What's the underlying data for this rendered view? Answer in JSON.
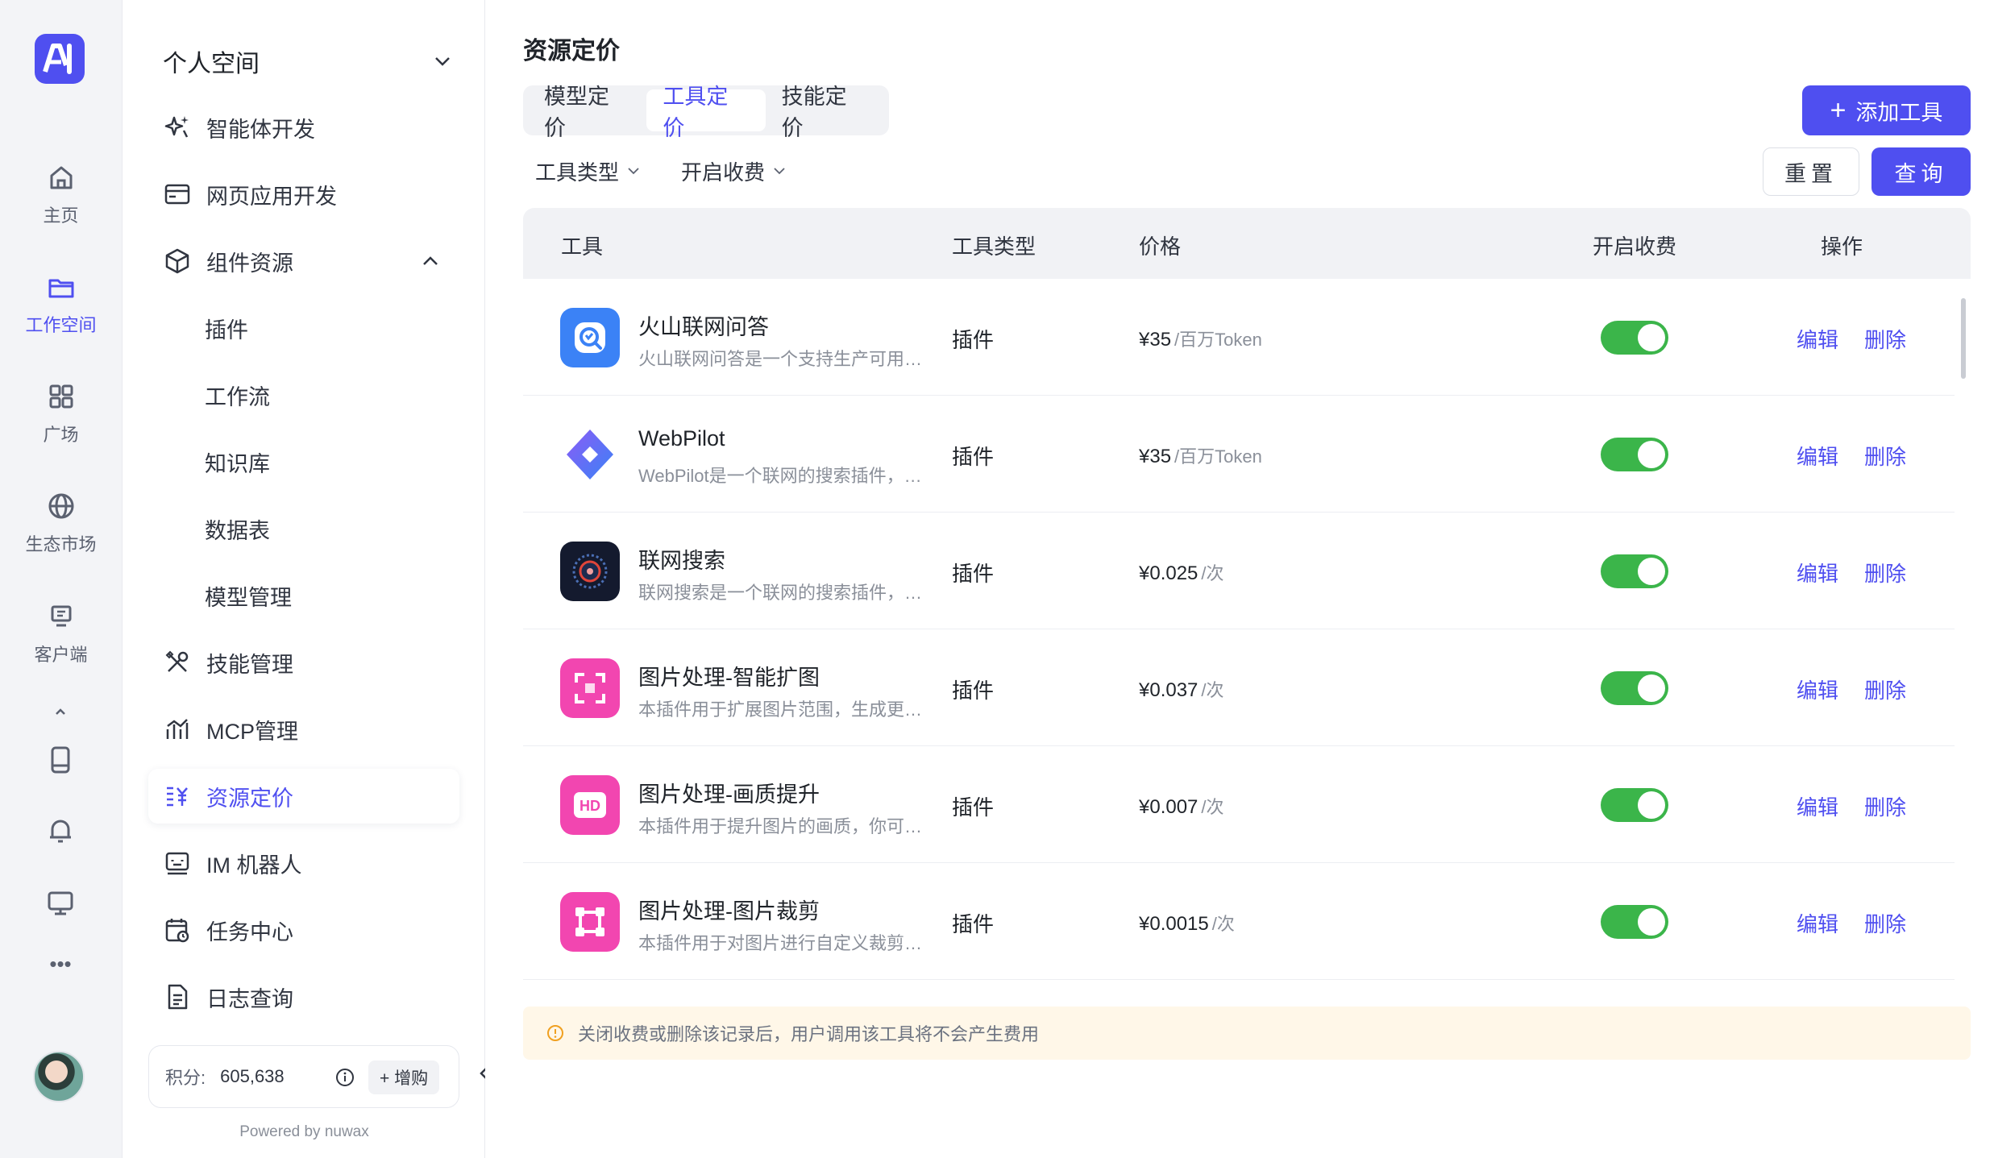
{
  "rail": {
    "items": [
      {
        "label": "主页",
        "icon": "home-icon"
      },
      {
        "label": "工作空间",
        "icon": "folder-icon",
        "active": true
      },
      {
        "label": "广场",
        "icon": "grid-icon"
      },
      {
        "label": "生态市场",
        "icon": "globe-icon"
      },
      {
        "label": "客户端",
        "icon": "client-icon"
      }
    ],
    "more_label": "•••"
  },
  "sidebar": {
    "workspace": "个人空间",
    "items": [
      {
        "label": "智能体开发"
      },
      {
        "label": "网页应用开发"
      },
      {
        "label": "组件资源"
      },
      {
        "label": "插件"
      },
      {
        "label": "工作流"
      },
      {
        "label": "知识库"
      },
      {
        "label": "数据表"
      },
      {
        "label": "模型管理"
      },
      {
        "label": "技能管理"
      },
      {
        "label": "MCP管理"
      },
      {
        "label": "资源定价"
      },
      {
        "label": "IM 机器人"
      },
      {
        "label": "任务中心"
      },
      {
        "label": "日志查询"
      }
    ],
    "credits_label": "积分:",
    "credits_value": "605,638",
    "buy_label": "+ 增购",
    "powered_by": "Powered by nuwax"
  },
  "main": {
    "title": "资源定价",
    "tabs": [
      "模型定价",
      "工具定价",
      "技能定价"
    ],
    "active_tab": "工具定价",
    "add_button": "添加工具",
    "filters": [
      "工具类型",
      "开启收费"
    ],
    "reset_button": "重置",
    "query_button": "查询",
    "columns": [
      "工具",
      "工具类型",
      "价格",
      "开启收费",
      "操作"
    ],
    "rows": [
      {
        "name": "火山联网问答",
        "desc": "火山联网问答是一个支持生产可用的联网问答插件",
        "type": "插件",
        "price": "¥35",
        "unit": "/百万Token",
        "enabled": true,
        "edit": "编辑",
        "delete": "删除"
      },
      {
        "name": "WebPilot",
        "desc": "WebPilot是一个联网的搜索插件，支持网页浏览",
        "type": "插件",
        "price": "¥35",
        "unit": "/百万Token",
        "enabled": true,
        "edit": "编辑",
        "delete": "删除"
      },
      {
        "name": "联网搜索",
        "desc": "联网搜索是一个联网的搜索插件，支持实时检索",
        "type": "插件",
        "price": "¥0.025",
        "unit": "/次",
        "enabled": true,
        "edit": "编辑",
        "delete": "删除"
      },
      {
        "name": "图片处理-智能扩图",
        "desc": "本插件用于扩展图片范围，生成更大尺寸的图片",
        "type": "插件",
        "price": "¥0.037",
        "unit": "/次",
        "enabled": true,
        "edit": "编辑",
        "delete": "删除"
      },
      {
        "name": "图片处理-画质提升",
        "desc": "本插件用于提升图片的画质，你可以上传图片",
        "type": "插件",
        "price": "¥0.007",
        "unit": "/次",
        "enabled": true,
        "edit": "编辑",
        "delete": "删除"
      },
      {
        "name": "图片处理-图片裁剪",
        "desc": "本插件用于对图片进行自定义裁剪处理",
        "type": "插件",
        "price": "¥0.0015",
        "unit": "/次",
        "enabled": true,
        "edit": "编辑",
        "delete": "删除"
      }
    ],
    "notice": "关闭收费或删除该记录后，用户调用该工具将不会产生费用"
  },
  "colors": {
    "accent": "#4f4ff0",
    "toggle_on": "#3bb54a",
    "notice_bg": "#fff7e8"
  }
}
